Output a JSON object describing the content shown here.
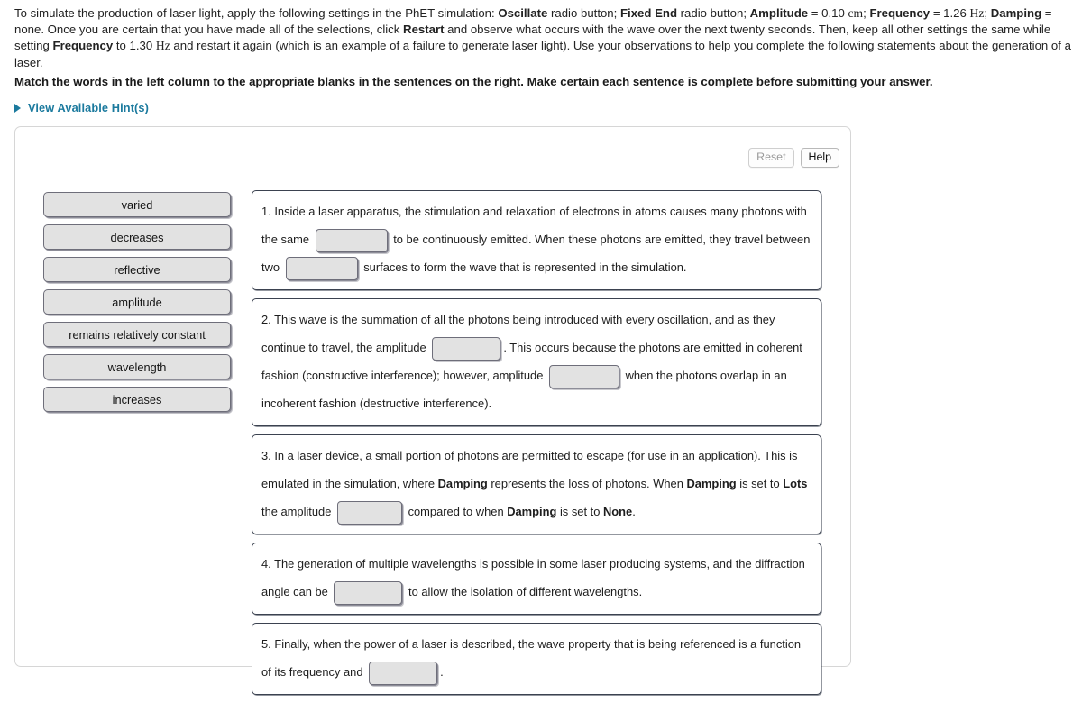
{
  "intro": {
    "part1": "To simulate the production of laser light, apply the following settings in the PhET simulation: ",
    "b1": "Oscillate",
    "part2": " radio button; ",
    "b2": "Fixed End",
    "part3": " radio button; ",
    "b3": "Amplitude",
    "part4": " = 0.10 ",
    "u1": "cm",
    "part5": "; ",
    "b4": "Frequency",
    "part6": " = 1.26 ",
    "u2": "Hz",
    "part7": "; ",
    "b5": "Damping",
    "part8": " = none. Once you are certain that you have made all of the selections, click ",
    "b6": "Restart",
    "part9": " and observe what occurs with the wave over the next twenty seconds. Then, keep all other settings the same while setting ",
    "b7": "Frequency",
    "part10": " to 1.30 ",
    "u3": "Hz",
    "part11": " and restart it again (which is an example of a failure to generate laser light). Use your observations to help you complete the following statements about the generation of a laser."
  },
  "match_instruction": "Match the words in the left column to the appropriate blanks in the sentences on the right. Make certain each sentence is complete before submitting your answer.",
  "hint": {
    "label": "View Available Hint(s)",
    "color": "#1b7a9e",
    "icon": "triangle-right-icon"
  },
  "toolbar": {
    "reset_label": "Reset",
    "help_label": "Help",
    "reset_disabled": true
  },
  "word_bank": {
    "items": [
      {
        "label": "varied"
      },
      {
        "label": "decreases"
      },
      {
        "label": "reflective"
      },
      {
        "label": "amplitude"
      },
      {
        "label": "remains relatively constant"
      },
      {
        "label": "wavelength"
      },
      {
        "label": "increases"
      }
    ]
  },
  "sentences": [
    {
      "id": "sentence-1",
      "s1": "1. Inside a laser apparatus, the stimulation and relaxation of electrons in atoms causes many photons with the same ",
      "s2": " to be continuously emitted. When these photons are emitted, they travel between two ",
      "s3": " surfaces to form the wave that is represented in the simulation.",
      "blank1_value": "",
      "blank2_value": ""
    },
    {
      "id": "sentence-2",
      "s1": "2. This wave is the summation of all the photons being introduced with every oscillation, and as they continue to travel, the amplitude ",
      "s2": ". This occurs because the photons are emitted in coherent fashion (constructive interference); however, amplitude ",
      "s3": " when the photons overlap in an incoherent fashion (destructive interference).",
      "blank1_value": "",
      "blank2_value": ""
    },
    {
      "id": "sentence-3",
      "s1": "3. In a laser device, a small portion of photons are permitted to escape (for use in an application). This is emulated in the simulation, where ",
      "b1": "Damping",
      "s2": " represents the loss of photons. When ",
      "b2": "Damping",
      "s3": " is set to ",
      "b3": "Lots",
      "s4": " the amplitude ",
      "s5": " compared to when ",
      "b4": "Damping",
      "s6": " is set to ",
      "b5": "None",
      "s7": ".",
      "blank1_value": ""
    },
    {
      "id": "sentence-4",
      "s1": "4. The generation of multiple wavelengths is possible in some laser producing systems, and the diffraction angle can be ",
      "s2": " to allow the isolation of different wavelengths.",
      "blank1_value": ""
    },
    {
      "id": "sentence-5",
      "s1": "5. Finally, when the power of a laser is described, the wave property that is being referenced is a function of its frequency and ",
      "s2": ".",
      "blank1_value": ""
    }
  ]
}
